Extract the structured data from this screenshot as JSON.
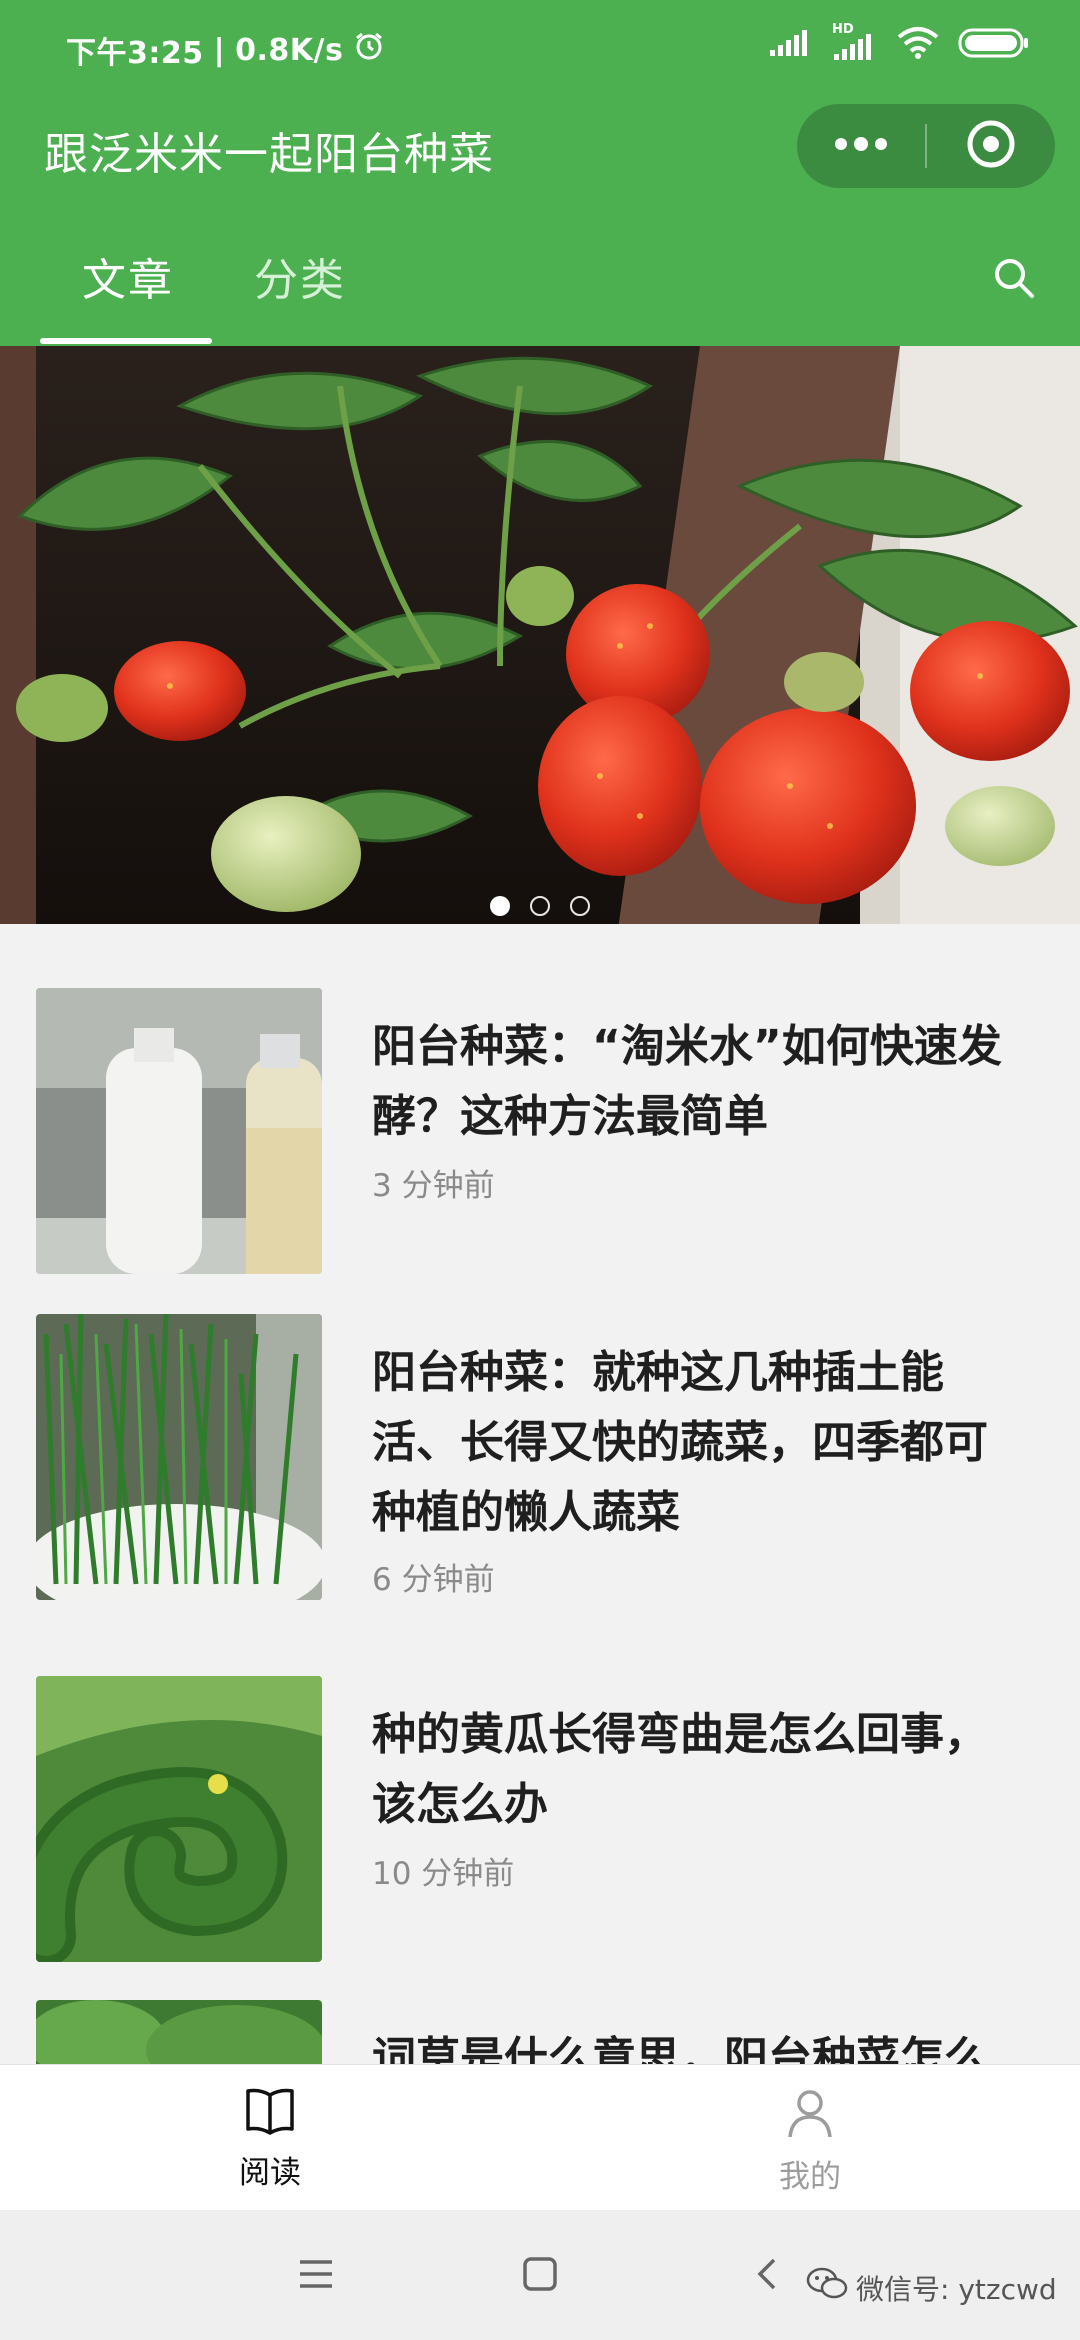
{
  "status_bar": {
    "time": "下午3:25",
    "network_speed": "0.8K/s",
    "separator": "|",
    "hd_label": "HD",
    "icons": [
      "alarm-icon",
      "signal-icon",
      "hd-signal-icon",
      "wifi-icon",
      "battery-icon"
    ]
  },
  "header": {
    "title": "跟泛米米一起阳台种菜",
    "more_icon": "more-dots-icon",
    "close_icon": "target-close-icon"
  },
  "tabs": {
    "items": [
      {
        "label": "文章",
        "active": true
      },
      {
        "label": "分类",
        "active": false
      }
    ],
    "search_icon": "search-icon"
  },
  "banner": {
    "subject": "strawberry-plant-photo",
    "dot_count": 3,
    "active_dot": 0
  },
  "articles": [
    {
      "title": "阳台种菜：“淘米水”如何快速发酵？这种方法最简单",
      "time": "3 分钟前",
      "thumb": "rice-water-bottles-photo"
    },
    {
      "title": "阳台种菜：就种这几种插土能活、长得又快的蔬菜，四季都可种植的懒人蔬菜",
      "time": "6 分钟前",
      "thumb": "green-onion-pot-photo"
    },
    {
      "title": "种的黄瓜长得弯曲是怎么回事，该怎么办",
      "time": "10 分钟前",
      "thumb": "curled-cucumber-photo"
    },
    {
      "title": "词草是什么意思，阳台种菜怎么",
      "time": "",
      "thumb": "leafy-greens-photo"
    }
  ],
  "tabbar": {
    "items": [
      {
        "label": "阅读",
        "icon": "book-icon",
        "active": true
      },
      {
        "label": "我的",
        "icon": "user-icon",
        "active": false
      }
    ]
  },
  "navbar": {
    "icons": [
      "menu-icon",
      "home-square-icon",
      "back-icon"
    ]
  },
  "watermark": {
    "text": "微信号: ytzcwd",
    "icon": "wechat-icon"
  },
  "colors": {
    "brand_green": "#4caf50",
    "capsule_green": "#3b8c40",
    "text_dark": "#1f1f1f",
    "text_muted": "#8a8a8a",
    "background": "#f2f2f2"
  }
}
